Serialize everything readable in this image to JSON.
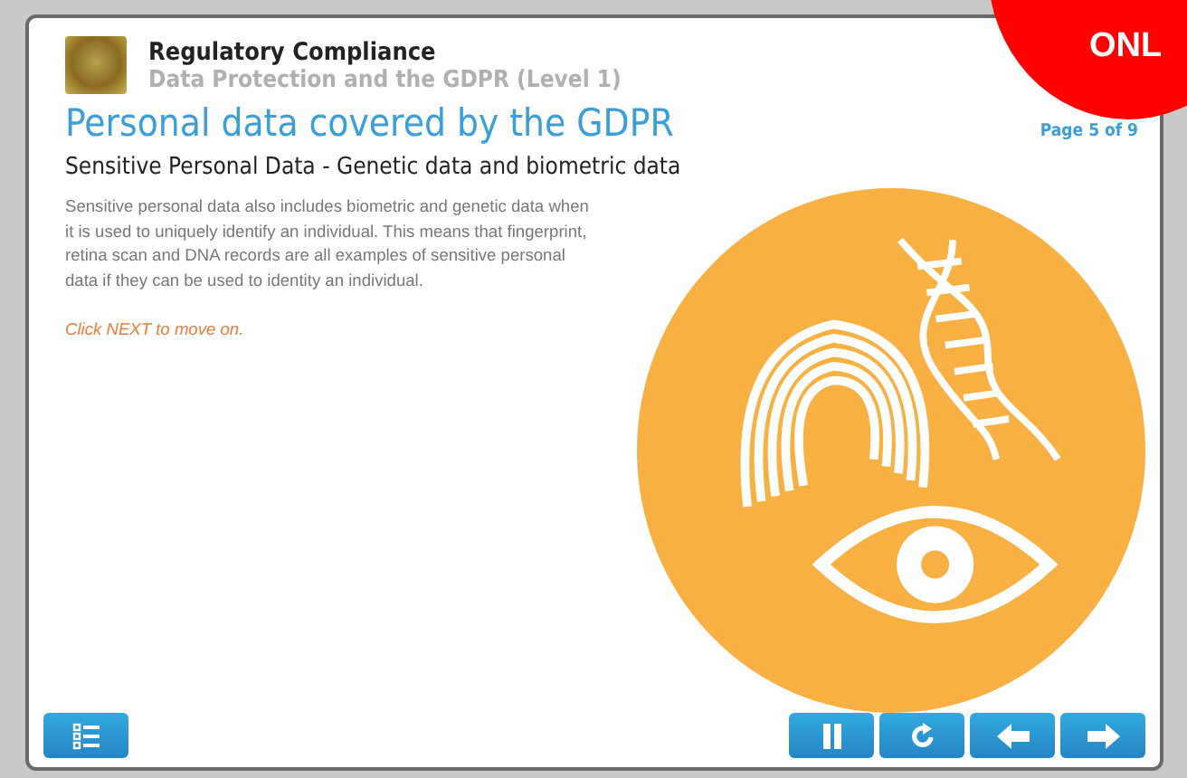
{
  "header": {
    "course": "Regulatory Compliance",
    "module": "Data Protection and the GDPR (Level 1)"
  },
  "badge": {
    "text": "ONL"
  },
  "page": {
    "title": "Personal data covered by the GDPR",
    "counter": "Page 5 of 9",
    "subtitle": "Sensitive Personal Data  - Genetic data and biometric data",
    "body": "Sensitive personal data also includes biometric and genetic data when it is used to uniquely identify an individual.   This means that fingerprint, retina scan and DNA records are all examples of sensitive personal data if they can be used to identity an individual.",
    "prompt": "Click NEXT to move on."
  },
  "controls": [
    {
      "kind": "menu"
    },
    {
      "kind": "pause"
    },
    {
      "kind": "replay"
    },
    {
      "kind": "back"
    },
    {
      "kind": "next"
    }
  ]
}
